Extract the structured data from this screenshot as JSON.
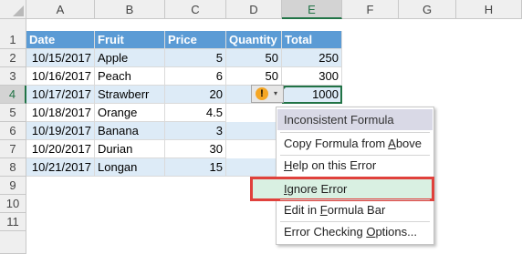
{
  "columns": [
    "A",
    "B",
    "C",
    "D",
    "E",
    "F",
    "G",
    "H"
  ],
  "rows": [
    "1",
    "2",
    "3",
    "4",
    "5",
    "6",
    "7",
    "8",
    "9",
    "10",
    "11"
  ],
  "table": {
    "headers": [
      "Date",
      "Fruit",
      "Price",
      "Quantity",
      "Total"
    ],
    "data": [
      [
        "10/15/2017",
        "Apple",
        "5",
        "50",
        "250"
      ],
      [
        "10/16/2017",
        "Peach",
        "6",
        "50",
        "300"
      ],
      [
        "10/17/2017",
        "Strawberr",
        "20",
        "",
        "1000"
      ],
      [
        "10/18/2017",
        "Orange",
        "4.5",
        "",
        ""
      ],
      [
        "10/19/2017",
        "Banana",
        "3",
        "",
        ""
      ],
      [
        "10/20/2017",
        "Durian",
        "30",
        "",
        ""
      ],
      [
        "10/21/2017",
        "Longan",
        "15",
        "",
        ""
      ]
    ]
  },
  "smart_tag": {
    "icon": "!",
    "arrow": "▾"
  },
  "context_menu": {
    "title": "Inconsistent Formula",
    "items": [
      {
        "pre": "Copy Formula from ",
        "key": "A",
        "post": "bove"
      },
      {
        "pre": "",
        "key": "H",
        "post": "elp on this Error"
      },
      {
        "pre": "",
        "key": "I",
        "post": "gnore Error"
      },
      {
        "pre": "Edit in ",
        "key": "F",
        "post": "ormula Bar"
      },
      {
        "pre": "Error Checking ",
        "key": "O",
        "post": "ptions..."
      }
    ]
  },
  "colors": {
    "header_fill": "#5b9bd5",
    "band_fill": "#ddebf7",
    "accent": "#217346",
    "highlight_border": "#e0413c"
  }
}
